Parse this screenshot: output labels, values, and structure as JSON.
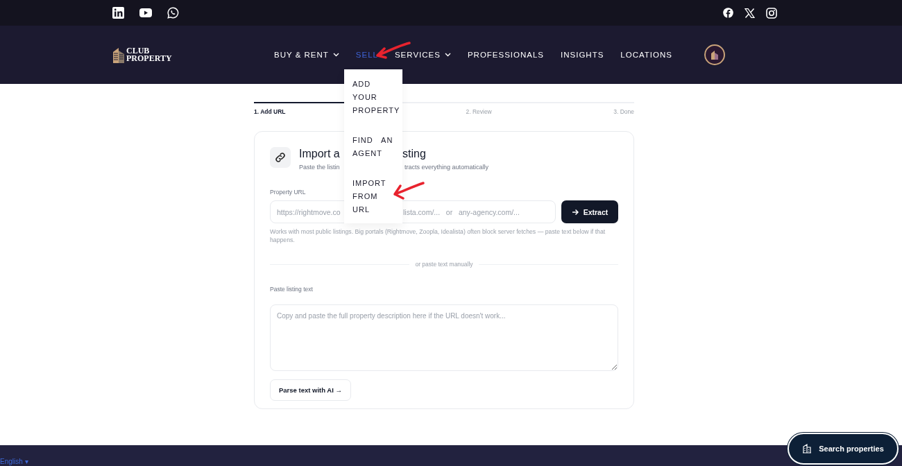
{
  "nav": {
    "logo": {
      "line1": "CLUB",
      "line2": "PROPERTY"
    },
    "items": [
      {
        "label": "BUY & RENT",
        "has_caret": true,
        "selected": false
      },
      {
        "label": "SELL",
        "has_caret": false,
        "selected": true
      },
      {
        "label": "SERVICES",
        "has_caret": true,
        "selected": false
      },
      {
        "label": "PROFESSIONALS",
        "has_caret": false,
        "selected": false
      },
      {
        "label": "INSIGHTS",
        "has_caret": false,
        "selected": false
      },
      {
        "label": "LOCATIONS",
        "has_caret": false,
        "selected": false
      }
    ]
  },
  "dropdown": {
    "items": [
      "ADD YOUR PROPERTY",
      "FIND AN AGENT",
      "IMPORT FROM URL"
    ]
  },
  "steps": [
    {
      "label": "1. Add URL",
      "selected": true
    },
    {
      "label": "2. Review",
      "selected": false
    },
    {
      "label": "3. Done",
      "selected": false
    }
  ],
  "card": {
    "title_parts": [
      "Import a",
      "sting"
    ],
    "subtitle_parts": [
      "Paste the listin",
      "tracts everything automatically"
    ],
    "url_label": "Property URL",
    "url_placeholder_parts": [
      "https://rightmove.co",
      "lista.com/...   or   any-agency.com/..."
    ],
    "extract_button": "Extract",
    "hint": "Works with most public listings. Big portals (Rightmove, Zoopla, Idealista) often block server fetches — paste text below if that happens.",
    "divider": "or paste text manually",
    "paste_label": "Paste listing text",
    "paste_placeholder": "Copy and paste the full property description here if the URL doesn't work...",
    "parse_button": "Parse text with AI →"
  },
  "footer": {
    "language": "English ▾"
  },
  "search_button": "Search properties"
}
